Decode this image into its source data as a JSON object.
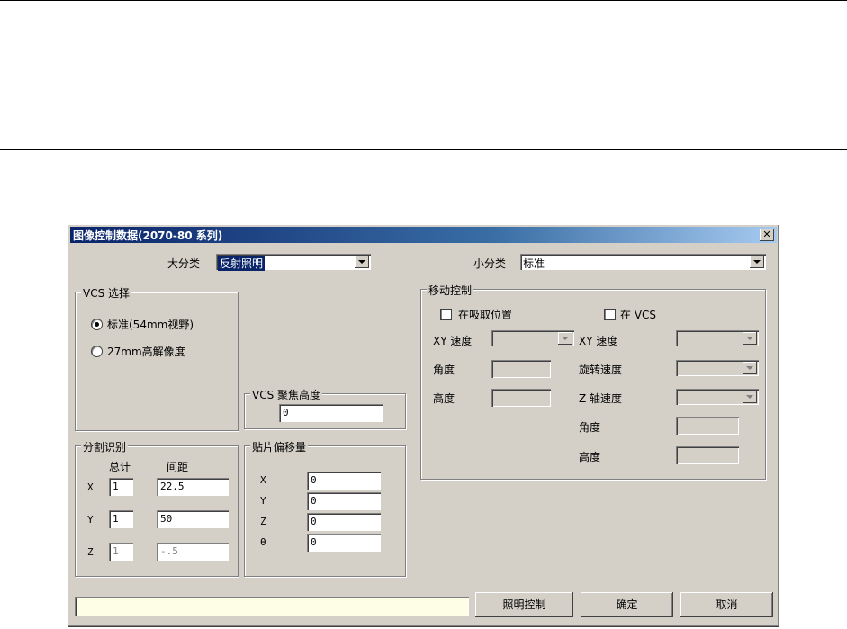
{
  "window": {
    "title": "图像控制数据(2070-80 系列)",
    "close_glyph": "✕"
  },
  "header": {
    "major_label": "大分类",
    "major_value": "反射照明",
    "minor_label": "小分类",
    "minor_value": "标准"
  },
  "vcs_select": {
    "title": "VCS 选择",
    "options": [
      "标准(54mm视野)",
      "27mm高解像度"
    ],
    "selected": 0
  },
  "vcs_focus": {
    "title": "VCS 聚焦高度",
    "value": "0"
  },
  "split": {
    "title": "分割识别",
    "col_total": "总计",
    "col_pitch": "间距",
    "rows": [
      {
        "axis": "X",
        "total": "1",
        "pitch": "22.5"
      },
      {
        "axis": "Y",
        "total": "1",
        "pitch": "50"
      },
      {
        "axis": "Z",
        "total": "1",
        "pitch": "-.5"
      }
    ]
  },
  "offset": {
    "title": "贴片偏移量",
    "rows": [
      {
        "axis": "X",
        "value": "0"
      },
      {
        "axis": "Y",
        "value": "0"
      },
      {
        "axis": "Z",
        "value": "0"
      },
      {
        "axis": "θ",
        "value": "0"
      }
    ]
  },
  "move": {
    "title": "移动控制",
    "left": {
      "checkbox": "在吸取位置",
      "xy_speed": "XY 速度",
      "angle": "角度",
      "height": "高度"
    },
    "right": {
      "checkbox": "在 VCS",
      "xy_speed": "XY 速度",
      "rot_speed": "旋转速度",
      "z_speed": "Z 轴速度",
      "angle": "角度",
      "height": "高度"
    }
  },
  "buttons": {
    "light": "照明控制",
    "ok": "确定",
    "cancel": "取消"
  }
}
